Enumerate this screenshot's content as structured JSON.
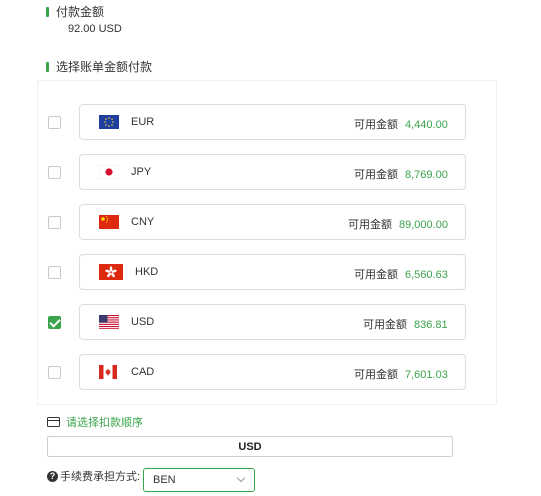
{
  "payment": {
    "title": "付款金额",
    "amount": "92.00 USD"
  },
  "select_section": {
    "title": "选择账单金额付款",
    "available_label": "可用金额",
    "currencies": [
      {
        "code": "EUR",
        "available": "4,440.00",
        "checked": false,
        "flag": "eu-flag-icon"
      },
      {
        "code": "JPY",
        "available": "8,769.00",
        "checked": false,
        "flag": "jp-flag-icon"
      },
      {
        "code": "CNY",
        "available": "89,000.00",
        "checked": false,
        "flag": "cn-flag-icon"
      },
      {
        "code": "HKD",
        "available": "6,560.63",
        "checked": false,
        "flag": "hk-flag-icon"
      },
      {
        "code": "USD",
        "available": "836.81",
        "checked": true,
        "flag": "us-flag-icon"
      },
      {
        "code": "CAD",
        "available": "7,601.03",
        "checked": false,
        "flag": "ca-flag-icon"
      }
    ]
  },
  "deduction": {
    "link_text": "请选择扣款顺序",
    "order_value": "USD"
  },
  "fee": {
    "label": "手续费承担方式:",
    "selected": "BEN"
  },
  "colors": {
    "accent": "#3aa44b"
  }
}
